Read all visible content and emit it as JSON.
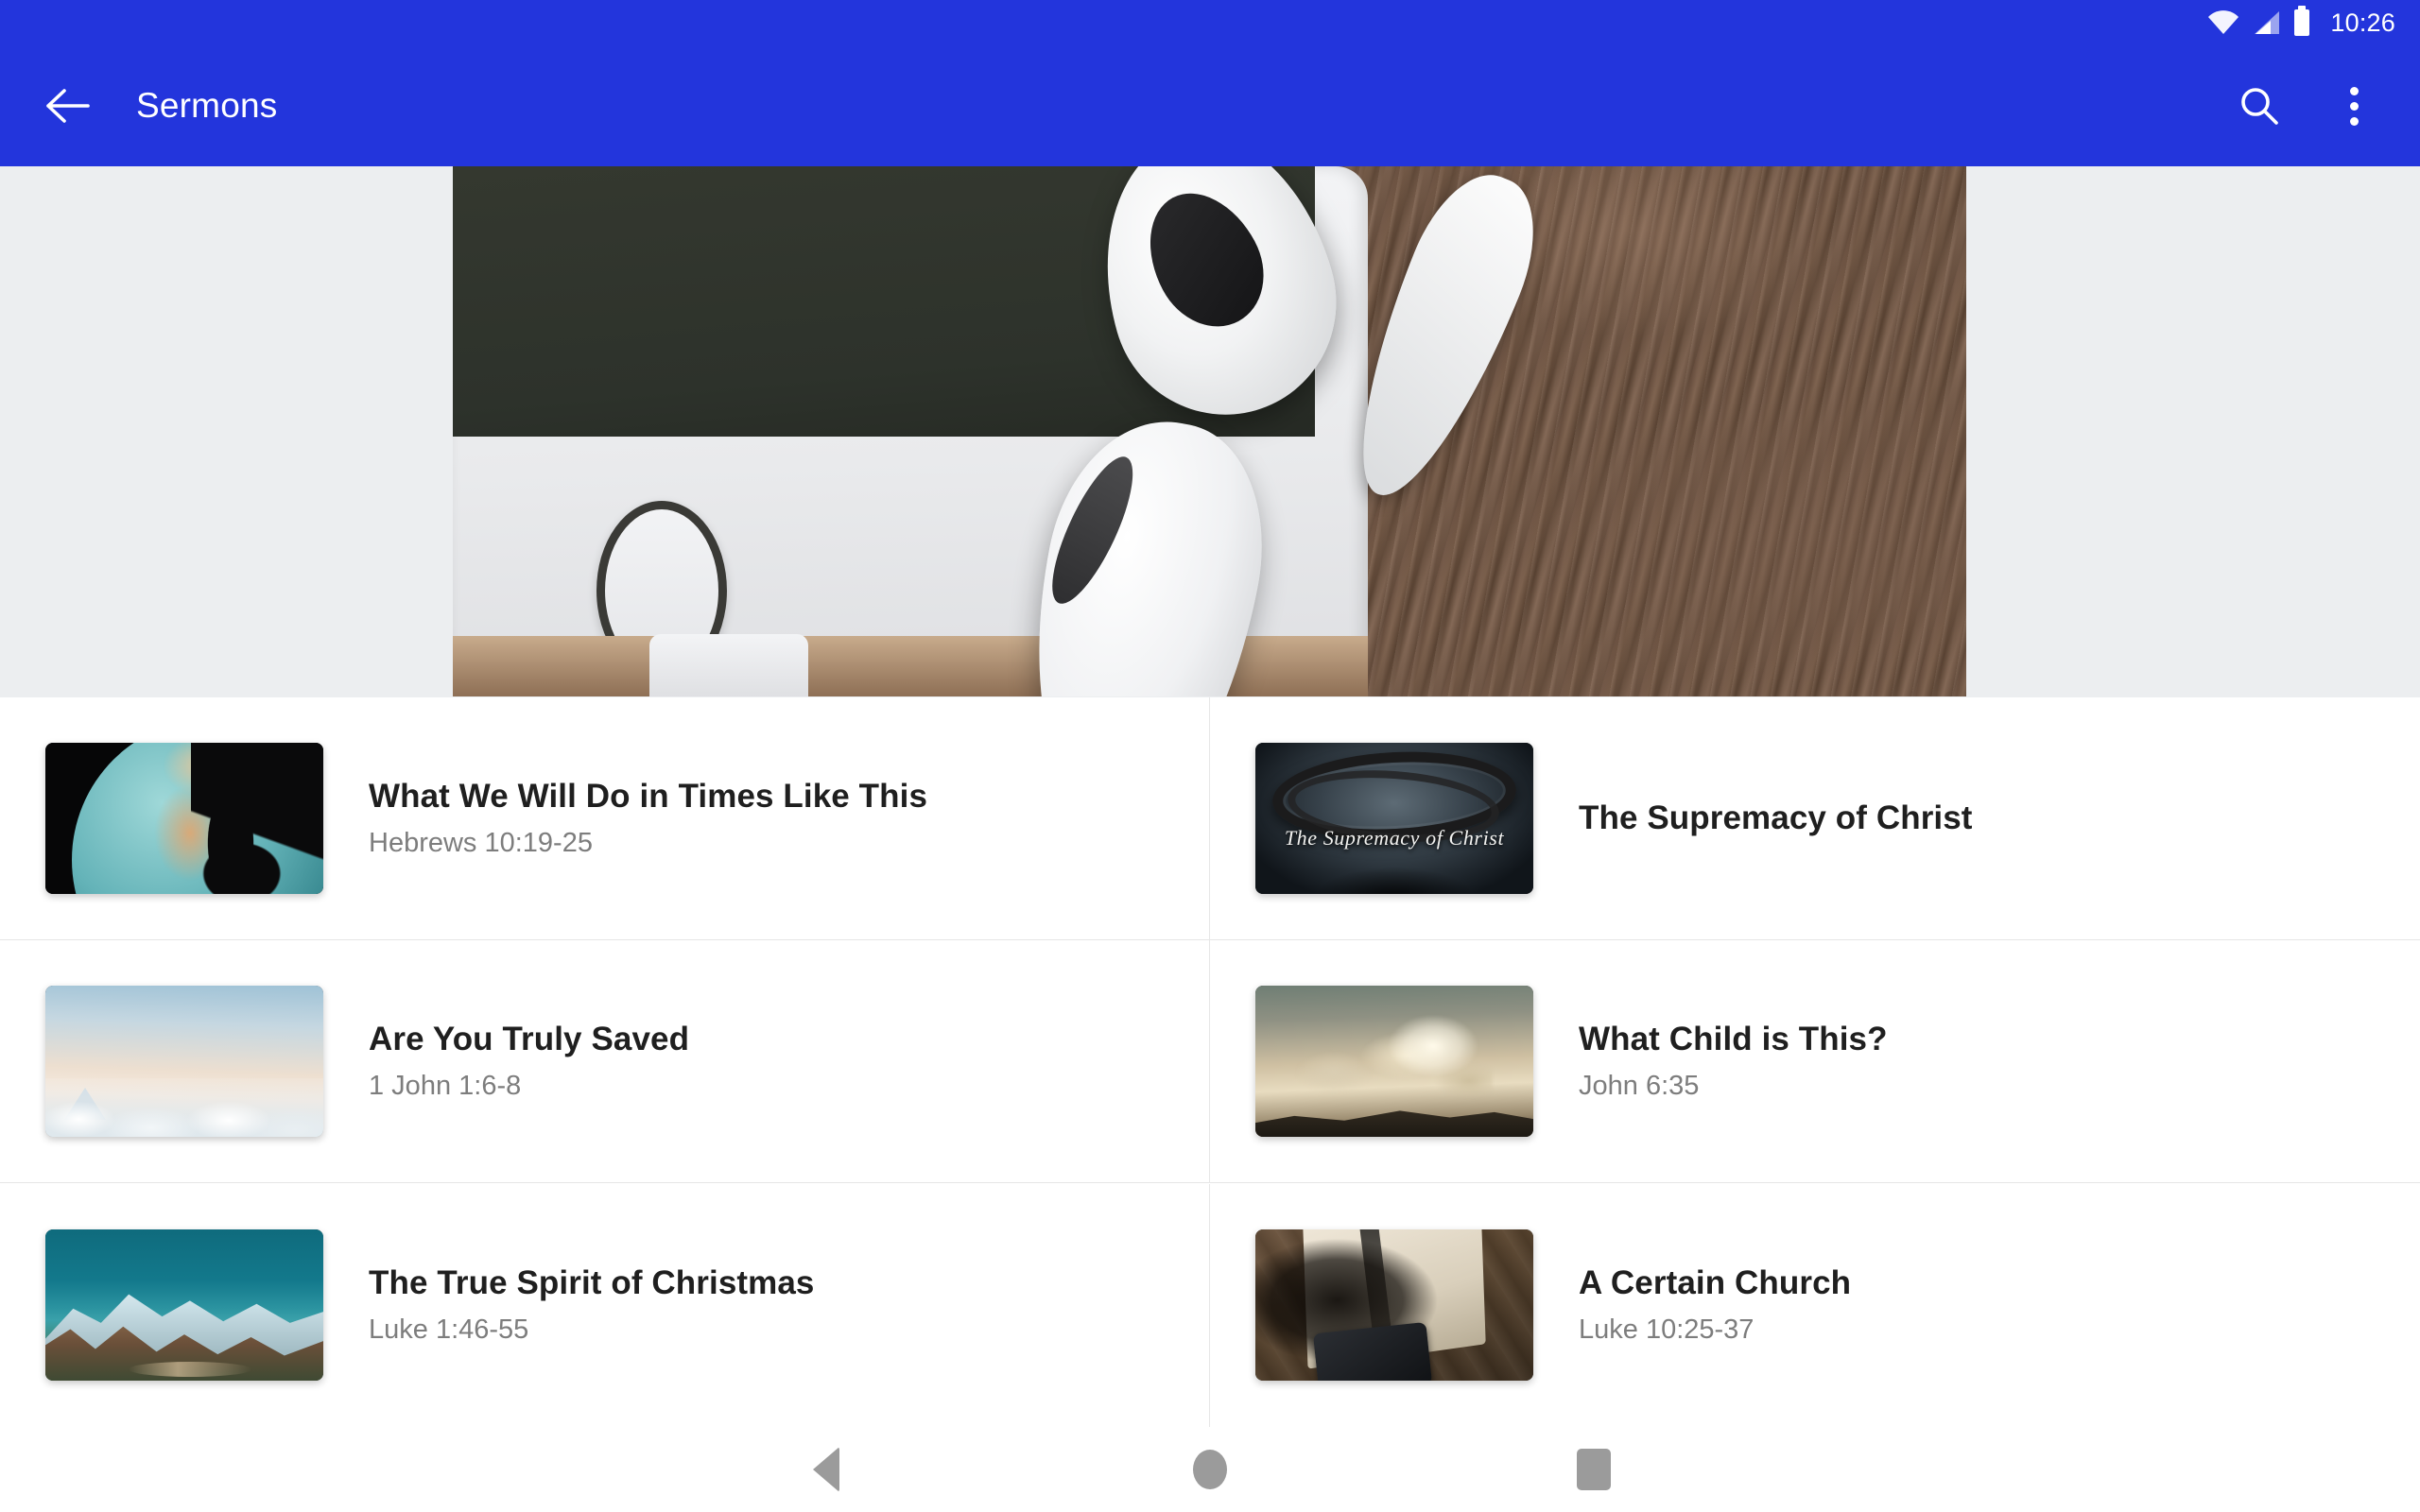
{
  "status_bar": {
    "time": "10:26",
    "icons": [
      "wifi-icon",
      "signal-icon",
      "battery-icon"
    ]
  },
  "app_bar": {
    "back_icon": "back-arrow-icon",
    "title": "Sermons",
    "search_icon": "search-icon",
    "overflow_icon": "more-vert-icon",
    "background_color": "#2335DC",
    "text_color": "#FFFFFF"
  },
  "hero": {
    "alt": "White smartphone with home button and white earbuds on a wooden surface",
    "background_color": "#ECEEF0"
  },
  "sermons": [
    {
      "title": "What We Will Do in Times Like This",
      "reference": "Hebrews 10:19-25",
      "thumbnail": "globe-with-hand-thumbnail"
    },
    {
      "title": "The Supremacy of Christ",
      "reference": "",
      "thumbnail": "crown-of-thorns-thumbnail",
      "thumbnail_caption": "The Supremacy of Christ"
    },
    {
      "title": "Are You Truly Saved",
      "reference": "1 John 1:6-8",
      "thumbnail": "pale-sky-clouds-thumbnail"
    },
    {
      "title": "What Child is This?",
      "reference": "John 6:35",
      "thumbnail": "sunbeam-clouds-thumbnail"
    },
    {
      "title": "The True Spirit of Christmas",
      "reference": "Luke 1:46-55",
      "thumbnail": "snowy-mountains-thumbnail"
    },
    {
      "title": "A Certain Church",
      "reference": "Luke 10:25-37",
      "thumbnail": "open-book-on-table-thumbnail"
    }
  ],
  "nav_bar": {
    "back": "back-triangle-icon",
    "home": "home-circle-icon",
    "recents": "recents-square-icon",
    "color": "#9B9B9B"
  },
  "colors": {
    "accent": "#2335DC",
    "title_text": "#1F1F1F",
    "subtitle_text": "#7D7D7D",
    "divider": "#E6E6E6",
    "surface": "#FFFFFF",
    "hero_backdrop": "#ECEEF0"
  }
}
